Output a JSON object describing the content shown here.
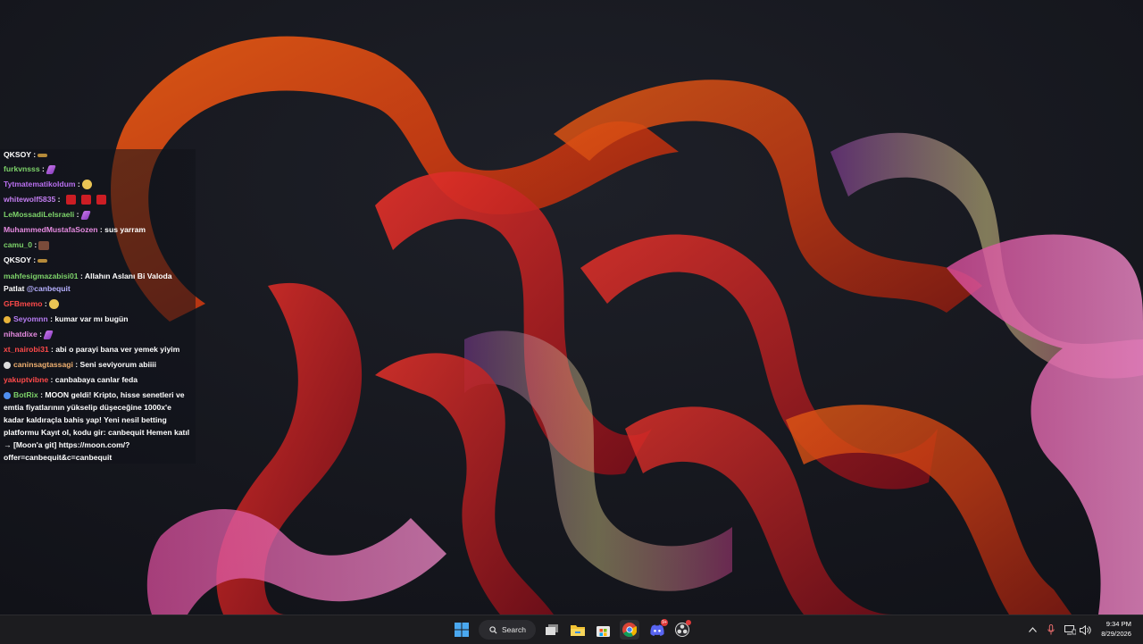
{
  "chat": {
    "messages": [
      {
        "user": "QKSOY",
        "color": "#ffffff",
        "sep": " :",
        "text": "",
        "emote": "bar"
      },
      {
        "user": "furkvnsss",
        "color": "#7dd36a",
        "sep": " :",
        "text": "",
        "emote": "feather"
      },
      {
        "user": "Tytmatematikoldum",
        "color": "#b96ff0",
        "sep": " :",
        "text": "",
        "emote": "face"
      },
      {
        "user": "whitewolf5835",
        "color": "#c27cf0",
        "sep": " :",
        "text": "",
        "emote": "red"
      },
      {
        "user": "LeMossadiLeIsraeli",
        "color": "#7dd36a",
        "sep": " :",
        "text": "",
        "emote": "feather"
      },
      {
        "user": "MuhammedMustafaSozen",
        "color": "#e58ae0",
        "sep": " :",
        "text": " sus yarram",
        "emote": ""
      },
      {
        "user": "camu_0",
        "color": "#7dd36a",
        "sep": " :",
        "text": "",
        "emote": "img"
      },
      {
        "user": "QKSOY",
        "color": "#ffffff",
        "sep": " :",
        "text": "",
        "emote": "bar"
      },
      {
        "user": "mahfesigmazabisi01",
        "color": "#7dd36a",
        "sep": " :",
        "text": " Allahın Aslanı Bi Valoda",
        "emote": ""
      },
      {
        "user": "",
        "color": "#ffffff",
        "sep": "",
        "text": "Patlat ",
        "emote": "",
        "mention": "@canbequit"
      },
      {
        "user": "GFBmemo",
        "color": "#ff4a4a",
        "sep": " :",
        "text": "",
        "emote": "face"
      },
      {
        "user": "Seyomnn",
        "color": "#b77cf3",
        "sep": " :",
        "text": " kumar var mı bugün",
        "emote": "",
        "badge": "#e8b33a"
      },
      {
        "user": "nihatdixe",
        "color": "#e58ae0",
        "sep": " :",
        "text": "",
        "emote": "feather"
      },
      {
        "user": "xt_nairobi31",
        "color": "#ff4a4a",
        "sep": " :",
        "text": " abi o parayi bana ver yemek yiyim",
        "emote": ""
      },
      {
        "user": "caninsagtassagi",
        "color": "#f0b070",
        "sep": " :",
        "text": " Seni seviyorum abiiii",
        "emote": "",
        "badge": "#dddddd"
      },
      {
        "user": "yakuptvibne",
        "color": "#ff4a4a",
        "sep": " :",
        "text": " canbabaya canlar feda",
        "emote": ""
      },
      {
        "user": "BotRix",
        "color": "#7dd36a",
        "sep": " :",
        "text": " MOON geldi! Kripto, hisse senetleri ve",
        "emote": "",
        "badge": "#4f8ff0"
      },
      {
        "user": "",
        "color": "#ffffff",
        "sep": "",
        "text": "emtia fiyatlarının yükselip düşeceğine 1000x'e",
        "emote": ""
      },
      {
        "user": "",
        "color": "#ffffff",
        "sep": "",
        "text": "kadar kaldıraçla bahis yap! Yeni nesil betting",
        "emote": ""
      },
      {
        "user": "",
        "color": "#ffffff",
        "sep": "",
        "text": "platformu Kayıt ol, kodu gir: canbequit Hemen katıl",
        "emote": ""
      },
      {
        "user": "",
        "color": "#ffffff",
        "sep": "",
        "text": "→ [Moon'a git] https://moon.com/?",
        "emote": ""
      },
      {
        "user": "",
        "color": "#ffffff",
        "sep": "",
        "text": "offer=canbequit&c=canbequit",
        "emote": ""
      }
    ]
  },
  "taskbar": {
    "search_label": "Search",
    "apps": [
      "start-icon",
      "search",
      "task-view-icon",
      "file-explorer-icon",
      "microsoft-store-icon",
      "chrome-icon",
      "discord-icon",
      "obs-icon"
    ],
    "discord_badge": "9+",
    "tray": [
      "chevron-up-icon",
      "microphone-icon",
      "display-icon",
      "speaker-icon"
    ],
    "time": "9:34 PM",
    "date": "8/29/2026"
  }
}
